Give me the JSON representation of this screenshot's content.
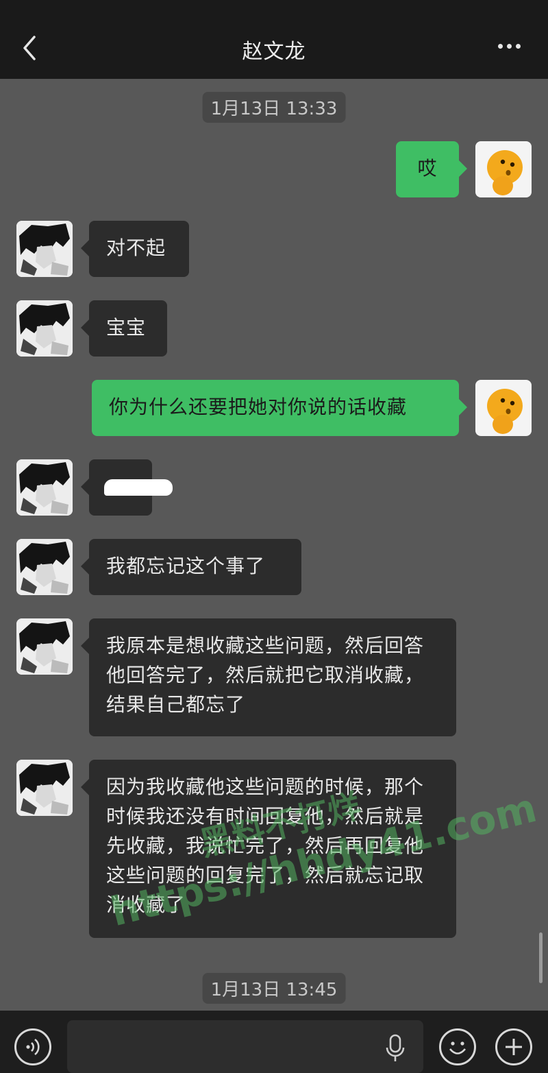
{
  "header": {
    "title": "赵文龙",
    "back_icon": "chevron-left-icon",
    "more_icon": "more-dots-icon"
  },
  "timestamps": [
    "1月13日 13:33",
    "1月13日 13:45"
  ],
  "messages": [
    {
      "sender": "me",
      "text": "哎"
    },
    {
      "sender": "other",
      "text": "对不起"
    },
    {
      "sender": "other",
      "text": "宝宝"
    },
    {
      "sender": "me",
      "text": "你为什么还要把她对你说的话收藏"
    },
    {
      "sender": "other",
      "text": "",
      "note": "redacted"
    },
    {
      "sender": "other",
      "text": "我都忘记这个事了"
    },
    {
      "sender": "other",
      "text": "我原本是想收藏这些问题，然后回答他回答完了，然后就把它取消收藏，结果自己都忘了"
    },
    {
      "sender": "other",
      "text": "因为我收藏他这些问题的时候，那个时候我还没有时间回复他，然后就是先收藏，我说忙完了，然后再回复他这些问题的回复完了，然后就忘记取消收藏了"
    }
  ],
  "watermark": {
    "line1": "黑料不打烊",
    "line2": "https://hhdy41.com"
  },
  "input_bar": {
    "voice_icon": "voice-icon",
    "mic_icon": "microphone-icon",
    "emoji_icon": "emoji-icon",
    "add_icon": "plus-circle-icon",
    "value": ""
  },
  "colors": {
    "header_bg": "#1a1a1a",
    "chat_bg": "#585858",
    "bubble_other": "#2c2c2c",
    "bubble_me": "#3fbe64",
    "bottom_bar": "#1e1e1e"
  }
}
